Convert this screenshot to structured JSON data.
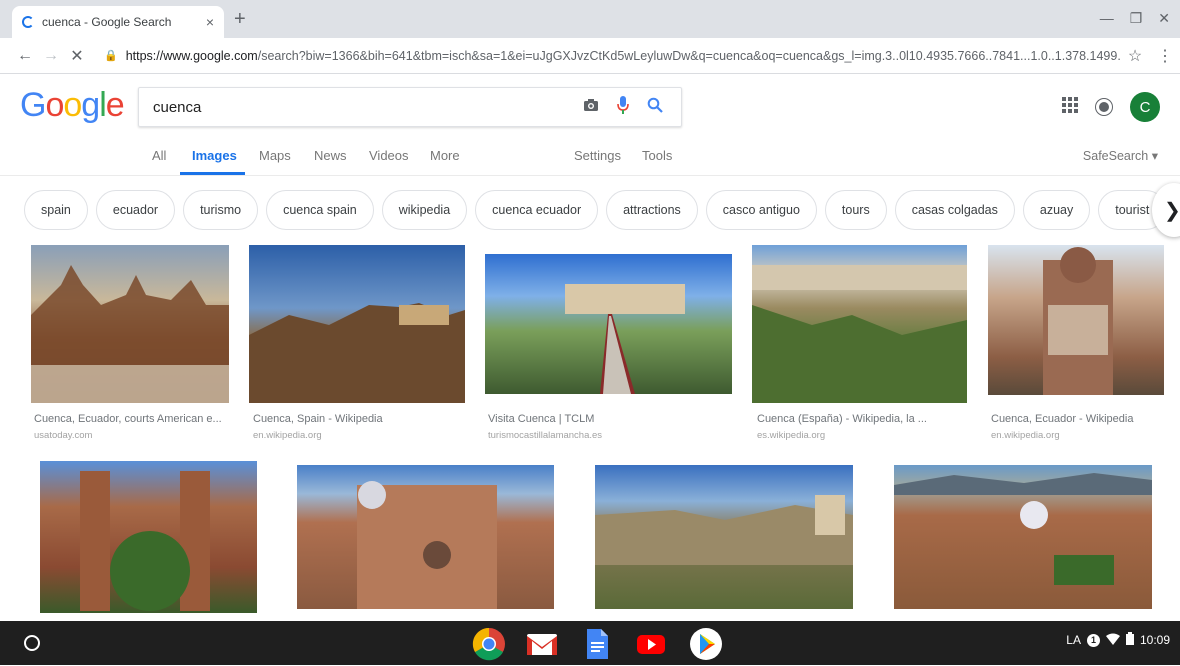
{
  "browser": {
    "tab_title": "cuenca - Google Search",
    "tab_close": "×",
    "new_tab": "+",
    "url_host": "https://www.google.com",
    "url_path": "/search?biw=1366&bih=641&tbm=isch&sa=1&ei=uJgGXJvzCtKd5wLeyluwDw&q=cuenca&oq=cuenca&gs_l=img.3..0l10.4935.7666..7841...1.0..1.378.1499..."
  },
  "header": {
    "search_value": "cuenca"
  },
  "nav_tabs": {
    "all": "All",
    "images": "Images",
    "maps": "Maps",
    "news": "News",
    "videos": "Videos",
    "more": "More",
    "settings": "Settings",
    "tools": "Tools",
    "safesearch": "SafeSearch ▾"
  },
  "avatar_letter": "C",
  "chips": [
    "spain",
    "ecuador",
    "turismo",
    "cuenca spain",
    "wikipedia",
    "cuenca ecuador",
    "attractions",
    "casco antiguo",
    "tours",
    "casas colgadas",
    "azuay",
    "tourist"
  ],
  "results": [
    {
      "caption": "Cuenca, Ecuador, courts American e...",
      "source": "usatoday.com"
    },
    {
      "caption": "Cuenca, Spain - Wikipedia",
      "source": "en.wikipedia.org"
    },
    {
      "caption": "Visita Cuenca | TCLM",
      "source": "turismocastillalamancha.es"
    },
    {
      "caption": "Cuenca (España) - Wikipedia, la ...",
      "source": "es.wikipedia.org"
    },
    {
      "caption": "Cuenca, Ecuador - Wikipedia",
      "source": "en.wikipedia.org"
    }
  ],
  "tray": {
    "ime": "LA",
    "clock": "10:09"
  },
  "colors": {
    "accent": "#1a73e8",
    "avatar": "#188038",
    "shelf": "#1f1f1f"
  }
}
